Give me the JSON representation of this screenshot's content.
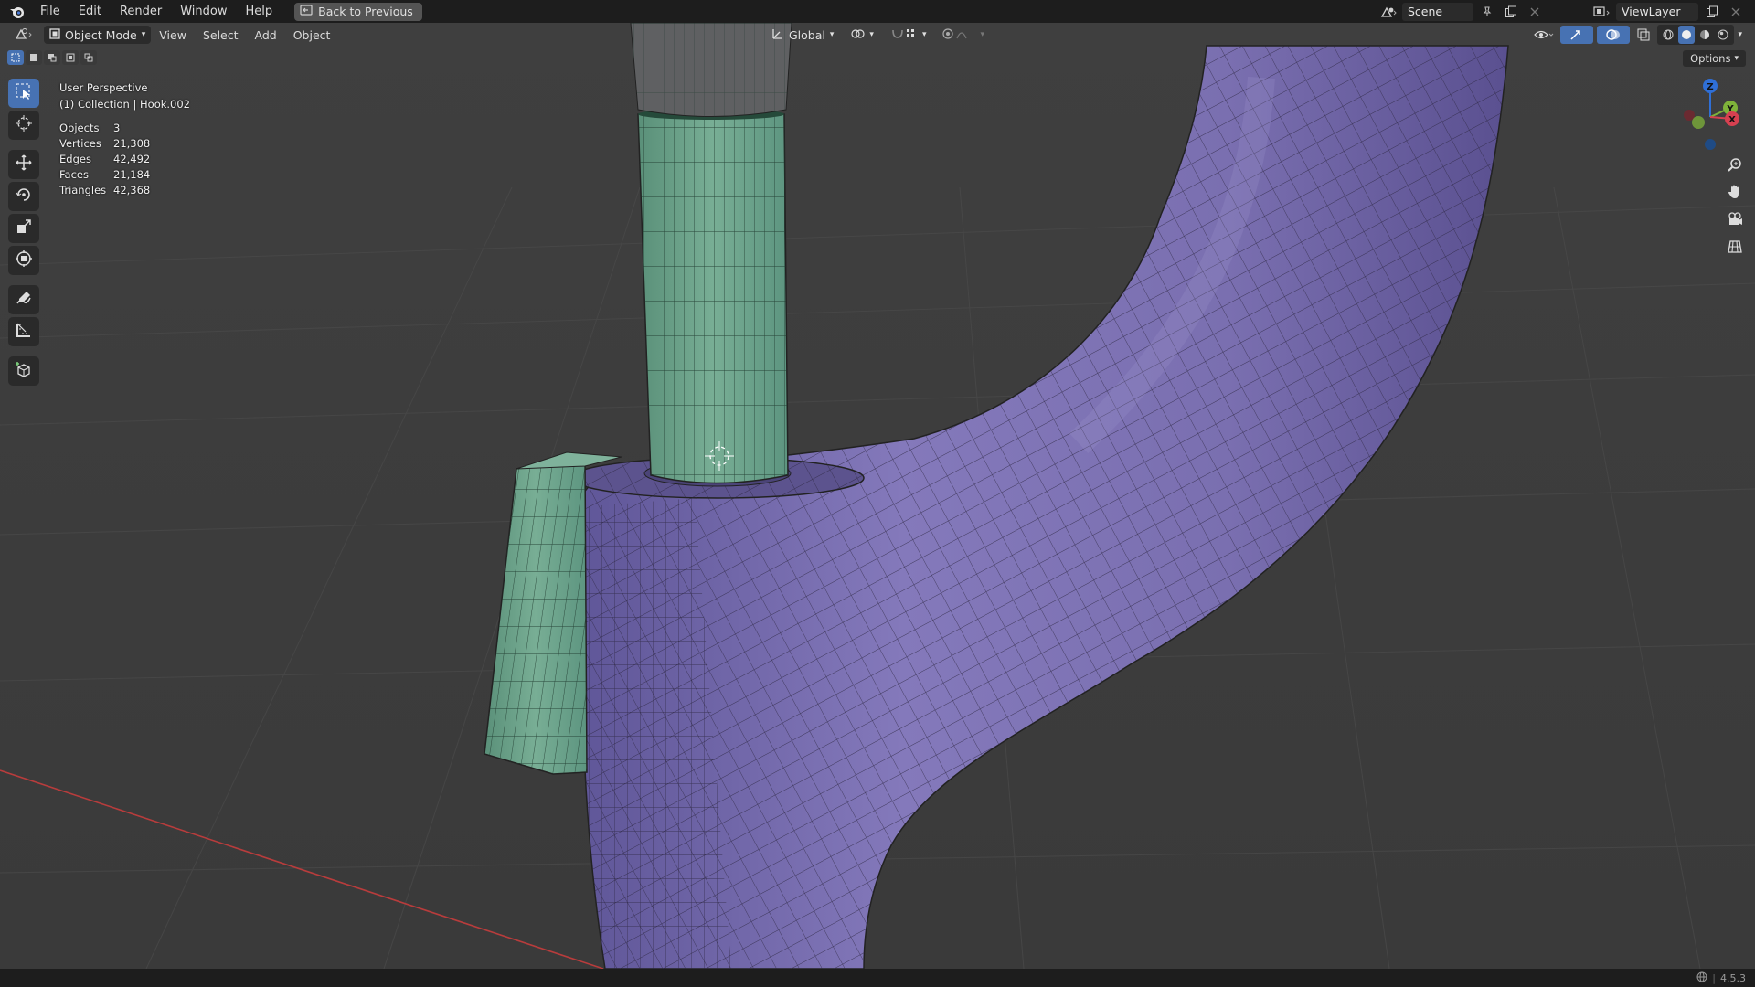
{
  "menu": {
    "items": [
      "File",
      "Edit",
      "Render",
      "Window",
      "Help"
    ],
    "back_button": "Back to Previous"
  },
  "scene": {
    "name": "Scene"
  },
  "view_layer": {
    "name": "ViewLayer"
  },
  "header": {
    "mode": "Object Mode",
    "menus": [
      "View",
      "Select",
      "Add",
      "Object"
    ],
    "transform_orientation": "Global"
  },
  "viewport": {
    "perspective": "User Perspective",
    "collection_info": "(1) Collection | Hook.002",
    "options_label": "Options"
  },
  "stats": [
    {
      "label": "Objects",
      "value": "3"
    },
    {
      "label": "Vertices",
      "value": "21,308"
    },
    {
      "label": "Edges",
      "value": "42,492"
    },
    {
      "label": "Faces",
      "value": "21,184"
    },
    {
      "label": "Triangles",
      "value": "42,368"
    }
  ],
  "gizmo": {
    "x_label": "X",
    "y_label": "Y",
    "z_label": "Z"
  },
  "status": {
    "version": "4.5.3"
  },
  "colors": {
    "accent": "#4772b3",
    "mesh_purple": "#7a6fb0",
    "mesh_green": "#6fa58c",
    "axis_red": "#c03a3a"
  },
  "icons": [
    "blender-logo",
    "back-icon",
    "scene-icon",
    "pin-icon",
    "copy-icon",
    "close-icon",
    "viewlayer-icon",
    "editor-type-icon",
    "object-mode-icon",
    "orientation-icon",
    "pivot-icon",
    "snap-icon",
    "proportional-icon",
    "select-box-icon",
    "cursor-icon",
    "move-icon",
    "rotate-icon",
    "scale-icon",
    "transform-icon",
    "annotate-icon",
    "measure-icon",
    "add-cube-icon",
    "zoom-icon",
    "hand-icon",
    "camera-icon",
    "grid-icon",
    "globe-icon"
  ]
}
